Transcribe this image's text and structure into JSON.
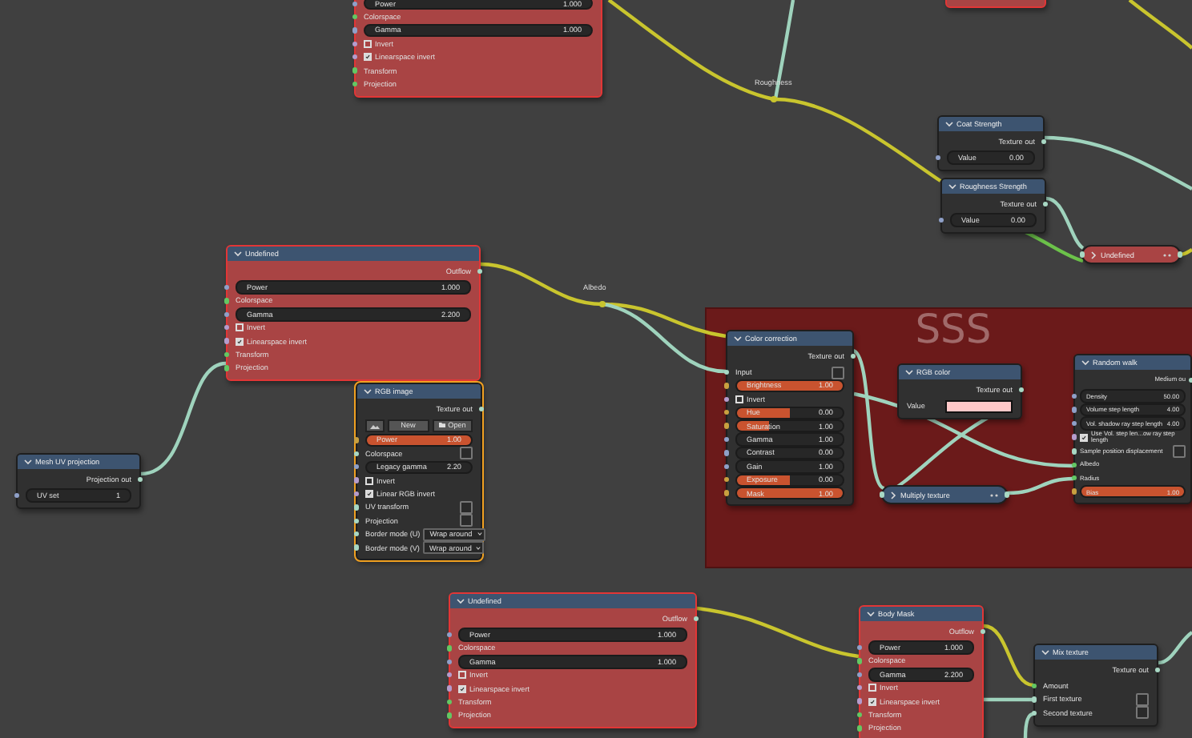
{
  "frames": [
    {
      "label": "SSS",
      "color": "#6b1a1a"
    }
  ],
  "reroutes": [
    {
      "label": "Roughness"
    },
    {
      "label": "Albedo"
    }
  ],
  "nodes": [
    {
      "color": "#a94444",
      "selected": true,
      "active": false,
      "collapsed": false,
      "rows": [
        {
          "kind": "field",
          "label": "Power",
          "value": "1.000"
        },
        {
          "kind": "input",
          "label": "Colorspace"
        },
        {
          "kind": "field",
          "label": "Gamma",
          "value": "1.000"
        },
        {
          "kind": "checkbox",
          "label": "Invert",
          "checked": false
        },
        {
          "kind": "checkbox",
          "label": "Linearspace invert",
          "checked": true
        },
        {
          "kind": "input",
          "label": "Transform"
        },
        {
          "kind": "input",
          "label": "Projection"
        }
      ]
    },
    {
      "color": "#a94444",
      "selected": true,
      "active": false,
      "collapsed": false
    },
    {
      "title": "Undefined",
      "color": "#a94444",
      "selected": true,
      "active": false,
      "collapsed": false,
      "rows": [
        {
          "kind": "output",
          "label": "Outflow"
        },
        {
          "kind": "field",
          "label": "Power",
          "value": "1.000"
        },
        {
          "kind": "input",
          "label": "Colorspace"
        },
        {
          "kind": "field",
          "label": "Gamma",
          "value": "2.200"
        },
        {
          "kind": "checkbox",
          "label": "Invert",
          "checked": false
        },
        {
          "kind": "checkbox",
          "label": "Linearspace invert",
          "checked": true
        },
        {
          "kind": "input",
          "label": "Transform"
        },
        {
          "kind": "input",
          "label": "Projection"
        }
      ]
    },
    {
      "title": "Mesh UV projection",
      "color": "#303030",
      "selected": false,
      "active": false,
      "collapsed": false,
      "rows": [
        {
          "kind": "output",
          "label": "Projection out"
        },
        {
          "kind": "field",
          "label": "UV set",
          "value": "1"
        }
      ]
    },
    {
      "title": "RGB image",
      "color": "#303030",
      "selected": false,
      "active": true,
      "collapsed": false,
      "rows": [
        {
          "kind": "output",
          "label": "Texture out"
        },
        {
          "kind": "image-buttons",
          "new": "New",
          "open": "Open"
        },
        {
          "kind": "slider",
          "label": "Power",
          "value": "1.00",
          "level": 1
        },
        {
          "kind": "option",
          "label": "Colorspace"
        },
        {
          "kind": "field",
          "label": "Legacy gamma",
          "value": "2.20"
        },
        {
          "kind": "checkbox",
          "label": "Invert",
          "checked": false
        },
        {
          "kind": "checkbox",
          "label": "Linear RGB invert",
          "checked": true
        },
        {
          "kind": "option",
          "label": "UV transform"
        },
        {
          "kind": "option",
          "label": "Projection"
        },
        {
          "kind": "dropdown",
          "label": "Border mode (U)",
          "value": "Wrap around"
        },
        {
          "kind": "dropdown",
          "label": "Border mode (V)",
          "value": "Wrap around"
        }
      ]
    },
    {
      "title": "Coat Strength",
      "color": "#303030",
      "selected": false,
      "active": false,
      "collapsed": false,
      "rows": [
        {
          "kind": "output",
          "label": "Texture out"
        },
        {
          "kind": "field",
          "label": "Value",
          "value": "0.00"
        }
      ]
    },
    {
      "title": "Roughness Strength",
      "color": "#303030",
      "selected": false,
      "active": false,
      "collapsed": false,
      "rows": [
        {
          "kind": "output",
          "label": "Texture out"
        },
        {
          "kind": "field",
          "label": "Value",
          "value": "0.00"
        }
      ]
    },
    {
      "title": "Undefined",
      "color": "#a94444",
      "selected": false,
      "active": false,
      "collapsed": true
    },
    {
      "title": "Color correction",
      "color": "#303030",
      "selected": false,
      "active": false,
      "collapsed": false,
      "rows": [
        {
          "kind": "output",
          "label": "Texture out"
        },
        {
          "kind": "option",
          "label": "Input"
        },
        {
          "kind": "slider",
          "label": "Brightness",
          "value": "1.00",
          "level": 1
        },
        {
          "kind": "checkbox",
          "label": "Invert",
          "checked": false
        },
        {
          "kind": "slider",
          "label": "Hue",
          "value": "0.00",
          "level": 0.5
        },
        {
          "kind": "slider",
          "label": "Saturation",
          "value": "1.00",
          "level": 0.3
        },
        {
          "kind": "field",
          "label": "Gamma",
          "value": "1.00"
        },
        {
          "kind": "field",
          "label": "Contrast",
          "value": "0.00"
        },
        {
          "kind": "field",
          "label": "Gain",
          "value": "1.00"
        },
        {
          "kind": "slider",
          "label": "Exposure",
          "value": "0.00",
          "level": 0.5
        },
        {
          "kind": "slider",
          "label": "Mask",
          "value": "1.00",
          "level": 1
        }
      ]
    },
    {
      "title": "RGB color",
      "color": "#303030",
      "selected": false,
      "active": false,
      "collapsed": false,
      "rows": [
        {
          "kind": "output",
          "label": "Texture out"
        },
        {
          "kind": "color",
          "label": "Value",
          "color": "#ffc8c8"
        }
      ]
    },
    {
      "title": "Multiply texture",
      "color": "#3d5470",
      "selected": false,
      "active": false,
      "collapsed": true
    },
    {
      "title": "Random walk",
      "color": "#303030",
      "selected": false,
      "active": false,
      "collapsed": false,
      "rows": [
        {
          "kind": "output",
          "label": "Medium ou"
        },
        {
          "kind": "field",
          "label": "Density",
          "value": "50.00"
        },
        {
          "kind": "field",
          "label": "Volume step length",
          "value": "4.00"
        },
        {
          "kind": "field",
          "label": "Vol. shadow ray step length",
          "value": "4.00"
        },
        {
          "kind": "checkbox",
          "label": "Use Vol. step len...ow ray step length",
          "checked": true
        },
        {
          "kind": "option",
          "label": "Sample position displacement"
        },
        {
          "kind": "input",
          "label": "Albedo"
        },
        {
          "kind": "input",
          "label": "Radius"
        },
        {
          "kind": "slider",
          "label": "Bias",
          "value": "1.00",
          "level": 1
        }
      ]
    },
    {
      "title": "Undefined",
      "color": "#a94444",
      "selected": true,
      "active": false,
      "collapsed": false,
      "rows": [
        {
          "kind": "output",
          "label": "Outflow"
        },
        {
          "kind": "field",
          "label": "Power",
          "value": "1.000"
        },
        {
          "kind": "input",
          "label": "Colorspace"
        },
        {
          "kind": "field",
          "label": "Gamma",
          "value": "1.000"
        },
        {
          "kind": "checkbox",
          "label": "Invert",
          "checked": false
        },
        {
          "kind": "checkbox",
          "label": "Linearspace invert",
          "checked": true
        },
        {
          "kind": "input",
          "label": "Transform"
        },
        {
          "kind": "input",
          "label": "Projection"
        }
      ]
    },
    {
      "title": "Body Mask",
      "color": "#a94444",
      "selected": true,
      "active": false,
      "collapsed": false,
      "rows": [
        {
          "kind": "output",
          "label": "Outflow"
        },
        {
          "kind": "field",
          "label": "Power",
          "value": "1.000"
        },
        {
          "kind": "input",
          "label": "Colorspace"
        },
        {
          "kind": "field",
          "label": "Gamma",
          "value": "2.200"
        },
        {
          "kind": "checkbox",
          "label": "Invert",
          "checked": false
        },
        {
          "kind": "checkbox",
          "label": "Linearspace invert",
          "checked": true
        },
        {
          "kind": "input",
          "label": "Transform"
        },
        {
          "kind": "input",
          "label": "Projection"
        }
      ]
    },
    {
      "title": "Mix texture",
      "color": "#303030",
      "selected": false,
      "active": false,
      "collapsed": false,
      "rows": [
        {
          "kind": "output",
          "label": "Texture out"
        },
        {
          "kind": "input",
          "label": "Amount"
        },
        {
          "kind": "option",
          "label": "First texture"
        },
        {
          "kind": "option",
          "label": "Second texture"
        }
      ]
    }
  ]
}
